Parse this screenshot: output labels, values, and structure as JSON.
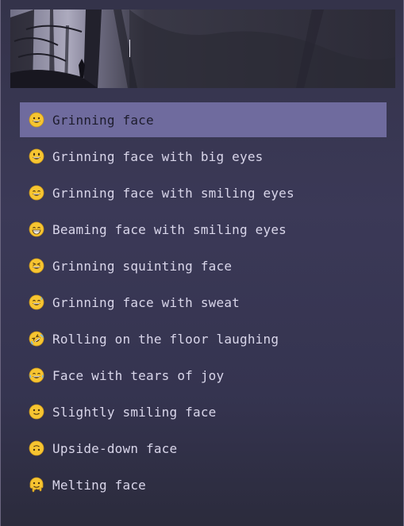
{
  "search": {
    "value": "",
    "placeholder": ""
  },
  "results": [
    {
      "label": "Grinning face",
      "icon": "grinning-face-icon",
      "selected": true
    },
    {
      "label": "Grinning face with big eyes",
      "icon": "grinning-face-big-eyes-icon",
      "selected": false
    },
    {
      "label": "Grinning face with smiling eyes",
      "icon": "grinning-face-smiling-eyes-icon",
      "selected": false
    },
    {
      "label": "Beaming face with smiling eyes",
      "icon": "beaming-face-icon",
      "selected": false
    },
    {
      "label": "Grinning squinting face",
      "icon": "grinning-squinting-face-icon",
      "selected": false
    },
    {
      "label": "Grinning face with sweat",
      "icon": "grinning-face-sweat-icon",
      "selected": false
    },
    {
      "label": "Rolling on the floor laughing",
      "icon": "rolling-laughing-icon",
      "selected": false
    },
    {
      "label": "Face with tears of joy",
      "icon": "tears-of-joy-icon",
      "selected": false
    },
    {
      "label": "Slightly smiling face",
      "icon": "slightly-smiling-face-icon",
      "selected": false
    },
    {
      "label": "Upside-down face",
      "icon": "upside-down-face-icon",
      "selected": false
    },
    {
      "label": "Melting face",
      "icon": "melting-face-icon",
      "selected": false
    }
  ],
  "colors": {
    "selected_bg": "#6f6b9e",
    "text": "#d9d6ea",
    "selected_text": "#1d1c2c",
    "emoji_yellow": "#f7c531"
  }
}
